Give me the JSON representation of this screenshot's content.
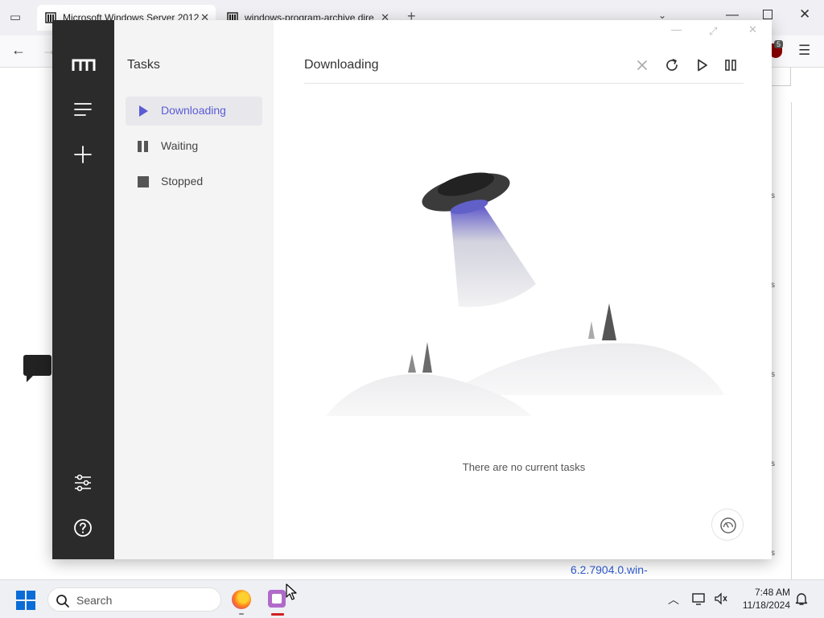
{
  "browser": {
    "tabs": [
      {
        "title": "Microsoft Windows Server 2012",
        "active": true
      },
      {
        "title": "windows-program-archive dire",
        "active": false
      }
    ],
    "new_tab_symbol": "+",
    "ublock_badge": "5",
    "page_link": "6.2.7904.0.win-",
    "page_snippets": [
      "s",
      "s",
      "s",
      "s",
      "s"
    ]
  },
  "app": {
    "nav_title": "Tasks",
    "nav_items": [
      {
        "label": "Downloading",
        "icon": "play-icon",
        "active": true
      },
      {
        "label": "Waiting",
        "icon": "pause-icon",
        "active": false
      },
      {
        "label": "Stopped",
        "icon": "stop-icon",
        "active": false
      }
    ],
    "content_title": "Downloading",
    "empty_message": "There are no current tasks",
    "toolbar_icons": [
      "close-icon",
      "refresh-icon",
      "play-icon",
      "pause-icon"
    ],
    "accent_color": "#5b5bd6",
    "rail_color": "#2b2b2b"
  },
  "taskbar": {
    "search_placeholder": "Search",
    "time": "7:48 AM",
    "date": "11/18/2024"
  }
}
